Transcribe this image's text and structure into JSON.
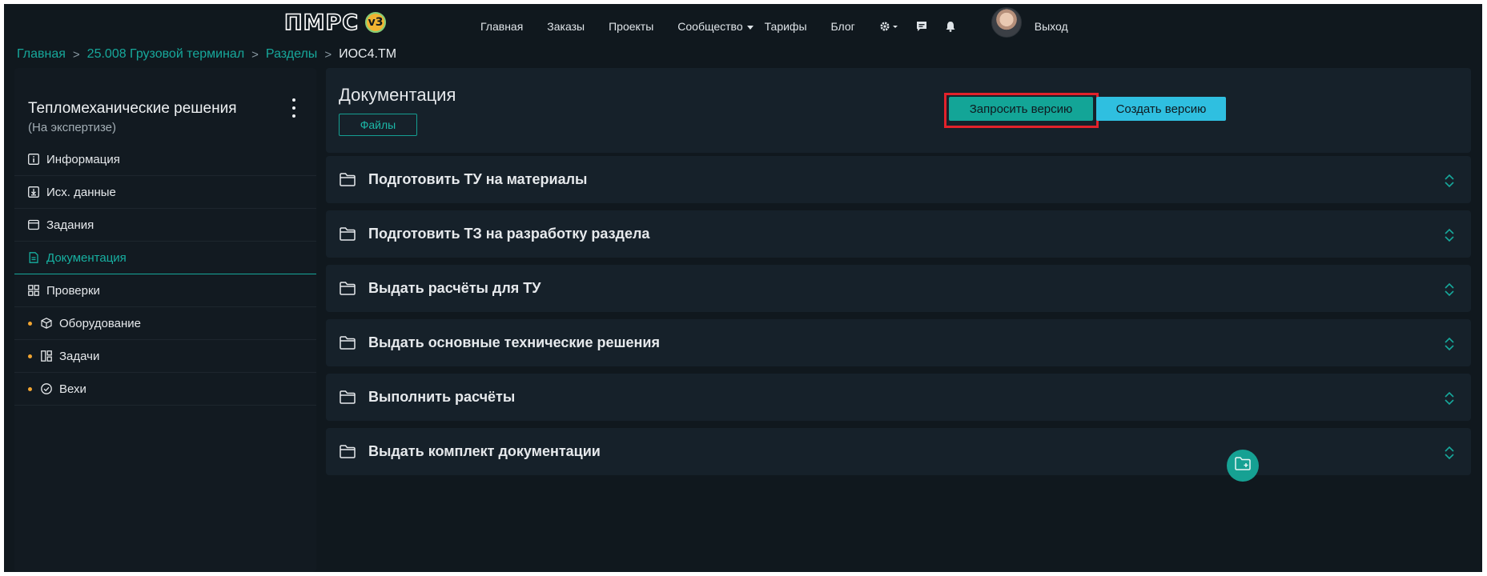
{
  "header": {
    "logo_text": "ПМРС",
    "logo_badge": "v3",
    "nav": [
      "Главная",
      "Заказы",
      "Проекты",
      "Сообщество",
      "Тарифы",
      "Блог"
    ],
    "logout": "Выход"
  },
  "breadcrumb": {
    "items": [
      "Главная",
      "25.008 Грузовой терминал",
      "Разделы"
    ],
    "current": "ИОС4.ТМ",
    "separator": ">"
  },
  "sidebar": {
    "title": "Тепломеханические решения",
    "status": "(На экспертизе)",
    "items": [
      {
        "label": "Информация",
        "icon": "info-icon"
      },
      {
        "label": "Исх. данные",
        "icon": "download-box-icon"
      },
      {
        "label": "Задания",
        "icon": "window-icon"
      },
      {
        "label": "Документация",
        "icon": "document-icon",
        "active": true
      },
      {
        "label": "Проверки",
        "icon": "grid-icon"
      },
      {
        "label": "Оборудование",
        "icon": "cube-icon",
        "dot": true
      },
      {
        "label": "Задачи",
        "icon": "kanban-icon",
        "dot": true
      },
      {
        "label": "Вехи",
        "icon": "check-circle-icon",
        "dot": true
      }
    ]
  },
  "main": {
    "title": "Документация",
    "files_button": "Файлы",
    "request_version": "Запросить версию",
    "create_version": "Создать версию",
    "folders": [
      "Подготовить ТУ на материалы",
      "Подготовить ТЗ на разработку раздела",
      "Выдать расчёты для ТУ",
      "Выдать основные технические решения",
      "Выполнить расчёты",
      "Выдать комплект документации"
    ]
  },
  "colors": {
    "accent": "#17a89b",
    "primary_button": "#13a597",
    "secondary_button": "#2fbfe0",
    "highlight": "#e2222b",
    "dot": "#f2a531"
  }
}
